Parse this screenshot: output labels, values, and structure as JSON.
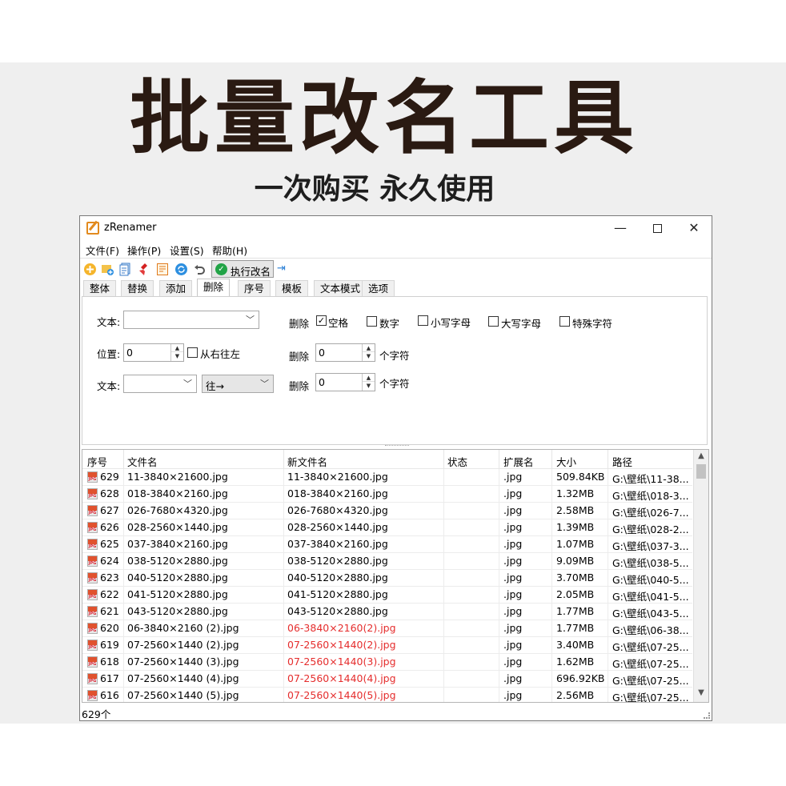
{
  "promo": {
    "title": "批量改名工具",
    "subtitle": "一次购买  永久使用"
  },
  "window": {
    "title": "zRenamer",
    "controls": {
      "minimize": "—",
      "close": "✕"
    }
  },
  "menu": [
    "文件(F)",
    "操作(P)",
    "设置(S)",
    "帮助(H)"
  ],
  "toolbar": {
    "icons": [
      "add-file-icon",
      "add-folder-icon",
      "copy-list-icon",
      "clear-list-icon",
      "edit-list-icon",
      "refresh-icon",
      "undo-icon"
    ],
    "execute_label": "执行改名",
    "pin_icon": "pin-icon"
  },
  "tabs": [
    "整体",
    "替换",
    "添加",
    "删除",
    "序号",
    "模板",
    "文本模式",
    "选项"
  ],
  "active_tab": "删除",
  "panel": {
    "text_label_1": "文本:",
    "text_value_1": "",
    "position_label": "位置:",
    "position_value": "0",
    "right_to_left_label": "从右往左",
    "right_to_left_checked": false,
    "text_label_2": "文本:",
    "text_value_2": "",
    "direction_value": "往→",
    "delete_label_1": "删除",
    "delete_label_2": "删除",
    "delete_label_3": "删除",
    "checkbox_space": {
      "label": "空格",
      "checked": true
    },
    "checkbox_digits": {
      "label": "数字",
      "checked": false
    },
    "checkbox_lower": {
      "label": "小写字母",
      "checked": false
    },
    "checkbox_upper": {
      "label": "大写字母",
      "checked": false
    },
    "checkbox_special": {
      "label": "特殊字符",
      "checked": false
    },
    "delete_count_1": "0",
    "delete_count_2": "0",
    "chars_unit_1": "个字符",
    "chars_unit_2": "个字符"
  },
  "table": {
    "columns": [
      "序号",
      "文件名",
      "新文件名",
      "状态",
      "扩展名",
      "大小",
      "路径"
    ],
    "rows": [
      {
        "idx": "629",
        "name": "11-3840×21600.jpg",
        "new": "11-3840×21600.jpg",
        "changed": false,
        "status": "",
        "ext": ".jpg",
        "size": "509.84KB",
        "path": "G:\\壁纸\\11-38..."
      },
      {
        "idx": "628",
        "name": "018-3840×2160.jpg",
        "new": "018-3840×2160.jpg",
        "changed": false,
        "status": "",
        "ext": ".jpg",
        "size": "1.32MB",
        "path": "G:\\壁纸\\018-3..."
      },
      {
        "idx": "627",
        "name": "026-7680×4320.jpg",
        "new": "026-7680×4320.jpg",
        "changed": false,
        "status": "",
        "ext": ".jpg",
        "size": "2.58MB",
        "path": "G:\\壁纸\\026-7..."
      },
      {
        "idx": "626",
        "name": "028-2560×1440.jpg",
        "new": "028-2560×1440.jpg",
        "changed": false,
        "status": "",
        "ext": ".jpg",
        "size": "1.39MB",
        "path": "G:\\壁纸\\028-2..."
      },
      {
        "idx": "625",
        "name": "037-3840×2160.jpg",
        "new": "037-3840×2160.jpg",
        "changed": false,
        "status": "",
        "ext": ".jpg",
        "size": "1.07MB",
        "path": "G:\\壁纸\\037-3..."
      },
      {
        "idx": "624",
        "name": "038-5120×2880.jpg",
        "new": "038-5120×2880.jpg",
        "changed": false,
        "status": "",
        "ext": ".jpg",
        "size": "9.09MB",
        "path": "G:\\壁纸\\038-5..."
      },
      {
        "idx": "623",
        "name": "040-5120×2880.jpg",
        "new": "040-5120×2880.jpg",
        "changed": false,
        "status": "",
        "ext": ".jpg",
        "size": "3.70MB",
        "path": "G:\\壁纸\\040-5..."
      },
      {
        "idx": "622",
        "name": "041-5120×2880.jpg",
        "new": "041-5120×2880.jpg",
        "changed": false,
        "status": "",
        "ext": ".jpg",
        "size": "2.05MB",
        "path": "G:\\壁纸\\041-5..."
      },
      {
        "idx": "621",
        "name": "043-5120×2880.jpg",
        "new": "043-5120×2880.jpg",
        "changed": false,
        "status": "",
        "ext": ".jpg",
        "size": "1.77MB",
        "path": "G:\\壁纸\\043-5..."
      },
      {
        "idx": "620",
        "name": "06-3840×2160 (2).jpg",
        "new": "06-3840×2160(2).jpg",
        "changed": true,
        "status": "",
        "ext": ".jpg",
        "size": "1.77MB",
        "path": "G:\\壁纸\\06-38..."
      },
      {
        "idx": "619",
        "name": "07-2560×1440 (2).jpg",
        "new": "07-2560×1440(2).jpg",
        "changed": true,
        "status": "",
        "ext": ".jpg",
        "size": "3.40MB",
        "path": "G:\\壁纸\\07-25..."
      },
      {
        "idx": "618",
        "name": "07-2560×1440 (3).jpg",
        "new": "07-2560×1440(3).jpg",
        "changed": true,
        "status": "",
        "ext": ".jpg",
        "size": "1.62MB",
        "path": "G:\\壁纸\\07-25..."
      },
      {
        "idx": "617",
        "name": "07-2560×1440 (4).jpg",
        "new": "07-2560×1440(4).jpg",
        "changed": true,
        "status": "",
        "ext": ".jpg",
        "size": "696.92KB",
        "path": "G:\\壁纸\\07-25..."
      },
      {
        "idx": "616",
        "name": "07-2560×1440 (5).jpg",
        "new": "07-2560×1440(5).jpg",
        "changed": true,
        "status": "",
        "ext": ".jpg",
        "size": "2.56MB",
        "path": "G:\\壁纸\\07-25..."
      }
    ]
  },
  "status": {
    "count": "629个"
  },
  "colors": {
    "changed_name": "#e52d2d",
    "title_text": "#2a1a12",
    "execute_icon": "#22a447"
  }
}
